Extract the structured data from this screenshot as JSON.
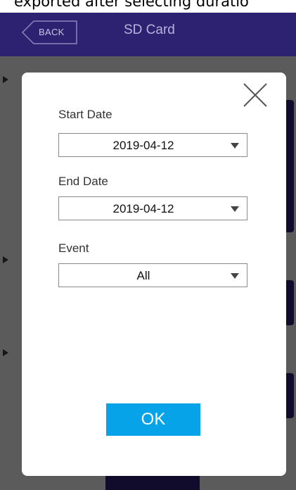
{
  "caption": {
    "text": "exported after selecting duratio"
  },
  "header": {
    "back_label": "BACK",
    "title": "SD Card"
  },
  "dialog": {
    "close_icon": "close-icon",
    "start_date": {
      "label": "Start Date",
      "value": "2019-04-12"
    },
    "end_date": {
      "label": "End Date",
      "value": "2019-04-12"
    },
    "event": {
      "label": "Event",
      "value": "All"
    },
    "ok_label": "OK"
  },
  "colors": {
    "header_bg": "#2d2172",
    "ok_button": "#06a3e8"
  }
}
